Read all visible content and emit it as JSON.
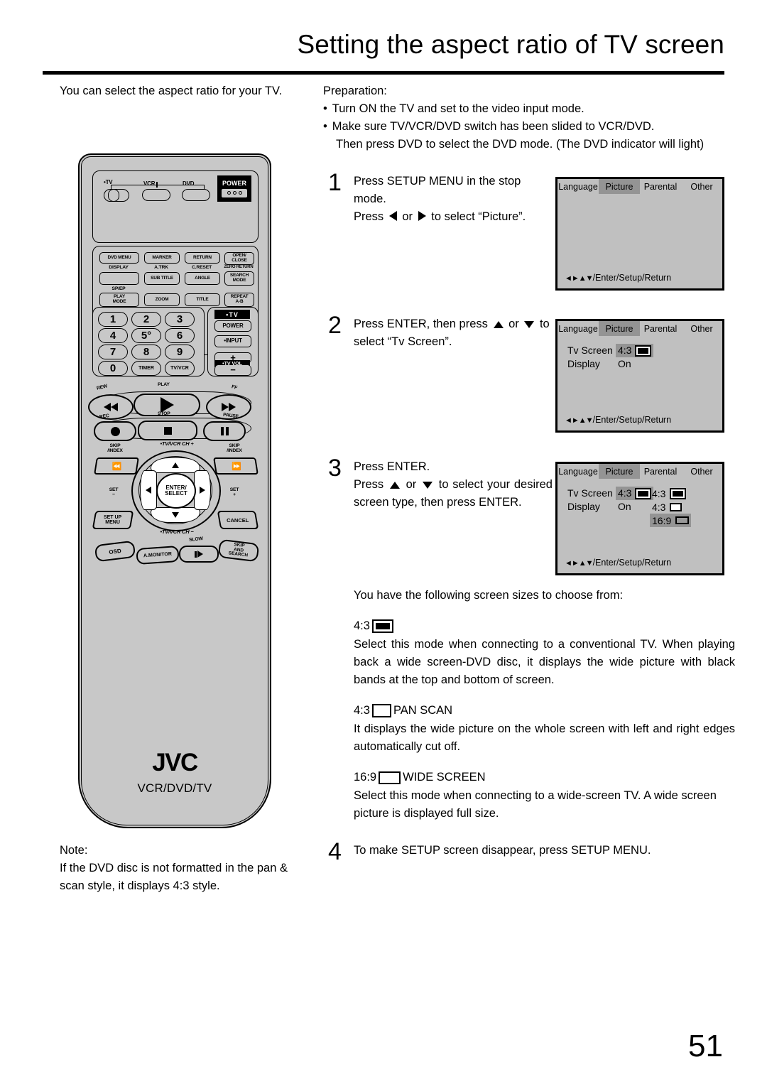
{
  "header": {
    "title": "Setting the aspect ratio of TV screen"
  },
  "intro": {
    "text": "You can select the aspect ratio for your TV."
  },
  "preparation": {
    "label": "Preparation:",
    "bullets": [
      "Turn ON the TV and set to the video input mode.",
      "Make sure TV/VCR/DVD switch has been slided to VCR/DVD."
    ],
    "continuation": "Then press DVD to select the DVD mode. (The DVD indicator will light)"
  },
  "steps": [
    {
      "num": "1",
      "line1": "Press SETUP MENU in the stop mode.",
      "line2_a": "Press",
      "line2_b": "or",
      "line2_c": "to select “Picture”."
    },
    {
      "num": "2",
      "line1_a": "Press ENTER, then press",
      "line1_b": "or",
      "line1_c": "to select “Tv Screen”."
    },
    {
      "num": "3",
      "line1": "Press ENTER.",
      "line2_a": "Press",
      "line2_b": "or",
      "line2_c": "to select your desired screen type, then press ENTER."
    },
    {
      "num": "4",
      "line1": "To make SETUP screen disappear, press SETUP MENU."
    }
  ],
  "osd": {
    "tabs": [
      "Language",
      "Picture",
      "Parental",
      "Other"
    ],
    "active_tab": "Picture",
    "footer": "/Enter/Setup/Return",
    "footer_arrows": "◄►▲▼",
    "screen1": {
      "rows": []
    },
    "screen2": {
      "rows": [
        {
          "name": "Tv Screen",
          "value": "4:3",
          "icon": "aspect-43-letterbox-icon",
          "highlight": true
        },
        {
          "name": "Display",
          "value": "On",
          "icon": "",
          "highlight": false
        }
      ]
    },
    "screen3": {
      "rows": [
        {
          "name": "Tv Screen",
          "value": "4:3",
          "icon": "aspect-43-letterbox-icon",
          "highlight": true
        },
        {
          "name": "Display",
          "value": "On",
          "icon": "",
          "highlight": false
        }
      ],
      "options": [
        {
          "value": "4:3",
          "icon": "aspect-43-letterbox-icon",
          "highlight": false
        },
        {
          "value": "4:3",
          "icon": "aspect-43-panscan-icon",
          "highlight": false
        },
        {
          "value": "16:9",
          "icon": "aspect-169-wide-icon",
          "highlight": true
        }
      ]
    }
  },
  "body": {
    "lead": "You have the following screen sizes to choose from:",
    "modes": [
      {
        "label": "4:3",
        "icon": "aspect-43-letterbox-icon",
        "suffix": "",
        "desc": "Select this mode when connecting to a conventional TV. When playing back a wide screen-DVD disc, it displays the wide picture with black bands at the top and bottom of screen."
      },
      {
        "label": "4:3",
        "icon": "aspect-43-panscan-icon",
        "suffix": "PAN SCAN",
        "desc": "It displays the wide picture on the whole screen with left and right edges automatically cut off."
      },
      {
        "label": "16:9",
        "icon": "aspect-169-wide-icon",
        "suffix": "WIDE SCREEN",
        "desc": "Select this mode when connecting to a wide-screen TV. A wide screen picture is displayed full size."
      }
    ]
  },
  "note": {
    "label": "Note:",
    "text": "If the DVD disc is not formatted in the pan & scan style, it displays 4:3 style."
  },
  "remote": {
    "brand": "JVC",
    "model": "VCR/DVD/TV",
    "mode_switch": {
      "tv": "•TV",
      "vcr": "VCR",
      "dvd": "DVD"
    },
    "power": "POWER",
    "row1": [
      "DVD MENU",
      "MARKER",
      "RETURN",
      "OPEN/\nCLOSE"
    ],
    "row2_top": [
      "DISPLAY",
      "A.TRK",
      "C.RESET",
      "ZERO RETURN"
    ],
    "row2": [
      "",
      "SUB TITLE",
      "ANGLE",
      "SEARCH\nMODE"
    ],
    "row3_top": [
      "SP/EP",
      "",
      "",
      ""
    ],
    "row3": [
      "PLAY\nMODE",
      "ZOOM",
      "TITLE",
      "REPEAT\nA-B"
    ],
    "numpad": [
      "1",
      "2",
      "3",
      "4",
      "5°",
      "6",
      "7",
      "8",
      "9",
      "0",
      "TIMER",
      "TV/VCR"
    ],
    "tv_side": {
      "tv": "•TV",
      "power": "POWER",
      "input": "•INPUT",
      "plus": "+",
      "vol": "•TV VOL",
      "minus": "−"
    },
    "transport_top": [
      "REW",
      "PLAY",
      "FF"
    ],
    "transport_bottom": [
      "REC",
      "STOP",
      "PAUSE"
    ],
    "skip_left": "SKIP\n/INDEX",
    "skip_right": "SKIP\n/INDEX",
    "ch_up": "•TV/VCR CH +",
    "ch_down": "•TV/VCR CH −",
    "set_minus": "SET\n−",
    "set_plus": "SET\n+",
    "enter": "ENTER/\nSELECT",
    "setup_menu": "SET UP\nMENU",
    "cancel": "CANCEL",
    "osd": "OSD",
    "a_monitor": "A.MONITOR",
    "slow": "SLOW",
    "skip_search": "SKIP\nAND\nSEARCH"
  },
  "page_number": "51"
}
